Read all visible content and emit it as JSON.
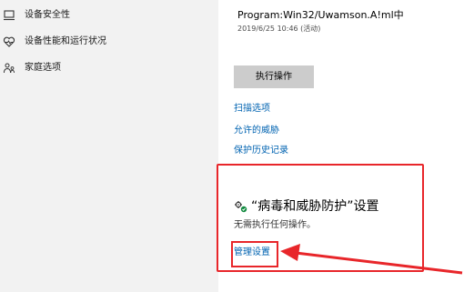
{
  "sidebar": {
    "items": [
      {
        "label": "设备安全性",
        "icon": "device-security-icon"
      },
      {
        "label": "设备性能和运行状况",
        "icon": "heart-health-icon"
      },
      {
        "label": "家庭选项",
        "icon": "family-icon"
      }
    ]
  },
  "threat": {
    "name": "Program:Win32/Uwamson.A!ml中",
    "date": "2019/6/25 10:46 (活动)",
    "action_label": "执行操作"
  },
  "links": {
    "scan_options": "扫描选项",
    "allowed_threats": "允许的威胁",
    "protection_history": "保护历史记录"
  },
  "settings_section": {
    "icon": "gear-shield-icon",
    "title": "“病毒和威胁防护”设置",
    "description": "无需执行任何操作。",
    "manage_link": "管理设置"
  },
  "colors": {
    "link": "#0063b1",
    "sidebar_bg": "#f2f2f2",
    "button_bg": "#cccccc",
    "annotation": "#e8262a",
    "status_green": "#10893e"
  }
}
